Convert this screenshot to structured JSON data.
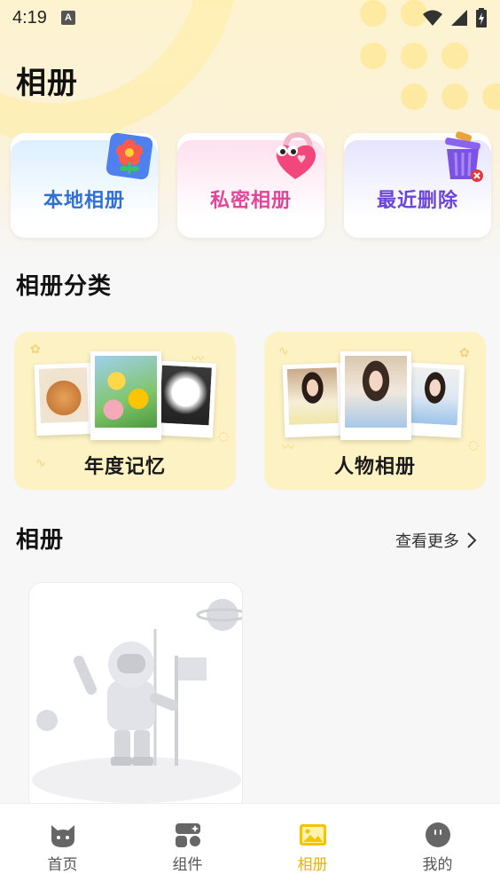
{
  "status_bar": {
    "time": "4:19",
    "badge": "A"
  },
  "page": {
    "title": "相册"
  },
  "quick_cards": [
    {
      "label": "本地相册",
      "icon": "flower-icon"
    },
    {
      "label": "私密相册",
      "icon": "heart-lock-icon"
    },
    {
      "label": "最近删除",
      "icon": "trash-bin-icon"
    }
  ],
  "categories": {
    "title": "相册分类",
    "items": [
      {
        "label": "年度记忆"
      },
      {
        "label": "人物相册"
      }
    ]
  },
  "albums": {
    "title": "相册",
    "more_label": "查看更多"
  },
  "bottom_nav": {
    "items": [
      {
        "label": "首页",
        "icon": "cat-face-icon",
        "active": false
      },
      {
        "label": "组件",
        "icon": "widgets-icon",
        "active": false
      },
      {
        "label": "相册",
        "icon": "picture-icon",
        "active": true
      },
      {
        "label": "我的",
        "icon": "smiley-icon",
        "active": false
      }
    ]
  },
  "colors": {
    "accent": "#e8b400",
    "local_album": "#2f6fd6",
    "private_album": "#e0479a",
    "recently_deleted": "#6b45d9"
  }
}
